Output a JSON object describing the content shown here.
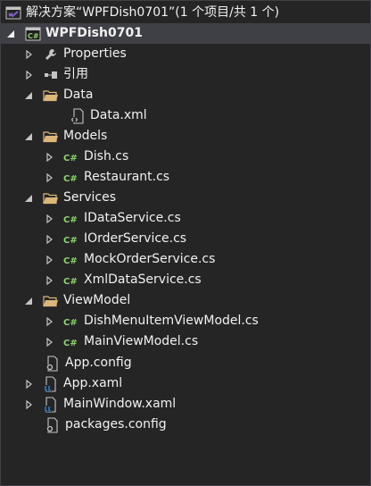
{
  "solution": {
    "label": "解决方案“WPFDish0701”(1 个项目/共 1 个)"
  },
  "project": {
    "label": "WPFDish0701"
  },
  "items": {
    "properties": "Properties",
    "references": "引用",
    "data_folder": "Data",
    "data_xml": "Data.xml",
    "models_folder": "Models",
    "dish_cs": "Dish.cs",
    "restaurant_cs": "Restaurant.cs",
    "services_folder": "Services",
    "idataservice_cs": "IDataService.cs",
    "iorderservice_cs": "IOrderService.cs",
    "mockorderservice_cs": "MockOrderService.cs",
    "xmldataservice_cs": "XmlDataService.cs",
    "viewmodel_folder": "ViewModel",
    "dishmenuitemviewmodel_cs": "DishMenuItemViewModel.cs",
    "mainviewmodel_cs": "MainViewModel.cs",
    "app_config": "App.config",
    "app_xaml": "App.xaml",
    "mainwindow_xaml": "MainWindow.xaml",
    "packages_config": "packages.config"
  },
  "colors": {
    "background": "#252526",
    "selected_row": "#3f3f46",
    "folder": "#dcb67a",
    "csharp": "#8fd16f",
    "vs_purple": "#865fc5",
    "xaml_blue": "#3b8cd6",
    "text": "#f1f1f1"
  }
}
